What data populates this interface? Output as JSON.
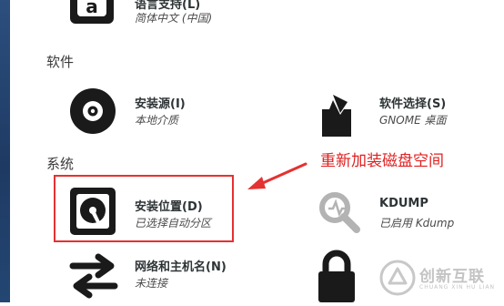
{
  "localization": {
    "language_support": {
      "title": "语言支持(L)",
      "status": "简体中文 (中国)",
      "icon": "language-icon"
    }
  },
  "sections": {
    "software": "软件",
    "system": "系统"
  },
  "software": {
    "install_source": {
      "title": "安装源(I)",
      "status": "本地介质",
      "icon": "disc-icon"
    },
    "software_selection": {
      "title": "软件选择(S)",
      "status": "GNOME 桌面",
      "icon": "package-icon"
    }
  },
  "system": {
    "install_destination": {
      "title": "安装位置(D)",
      "status": "已选择自动分区",
      "icon": "harddisk-icon"
    },
    "kdump": {
      "title": "KDUMP",
      "status": "已启用 Kdump",
      "icon": "kdump-search-icon"
    },
    "network_hostname": {
      "title": "网络和主机名(N)",
      "status": "未连接",
      "icon": "network-arrows-icon"
    },
    "security": {
      "icon": "lock-icon"
    }
  },
  "annotation": {
    "text": "重新加装磁盘空间",
    "color": "#e02020"
  },
  "watermark": {
    "text": "创新互联",
    "sub": "CHUANG XIN HU LIAN"
  },
  "colors": {
    "sidebar": "#234672",
    "highlight_border": "#e53131",
    "icon_dark": "#1a1a1a",
    "icon_gray": "#b3b3b3"
  }
}
